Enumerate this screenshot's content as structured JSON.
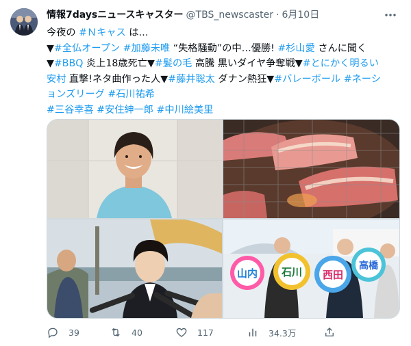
{
  "tweet": {
    "author_name": "情報7daysニュースキャスター",
    "handle": "@TBS_newscaster",
    "separator": "·",
    "date": "6月10日",
    "more_icon": "more-horizontal-icon",
    "body": {
      "l1": {
        "a": "今夜の ",
        "tag1": "#Ｎキャス",
        "b": " は…"
      },
      "l2": {
        "a": "▼",
        "tag1": "#全仏オープン",
        "b": " ",
        "tag2": "#加藤未唯",
        "c": " “失格騒動”の中…優勝! ",
        "tag3": "#杉山愛",
        "d": " さんに聞く"
      },
      "l3": {
        "a": "▼",
        "tag1": "#BBQ",
        "b": " 炎上18歳死亡▼",
        "tag2": "#髪の毛",
        "c": " 高騰 黒いダイヤ争奪戦▼",
        "tag3": "#とにかく明るい"
      },
      "l4": {
        "tag1": "安村",
        "a": " 直撃!ネタ曲作った人▼",
        "tag2": "#藤井聡太",
        "b": " ダナン熱狂▼",
        "tag3": "#バレーボール",
        "c": " ",
        "tag4": "#ネーシ"
      },
      "l5": {
        "tag1": "ョンズリーグ",
        "a": " ",
        "tag2": "#石川祐希"
      },
      "l6": {
        "tag1": "#三谷幸喜",
        "a": " ",
        "tag2": "#安住紳一郎",
        "b": " ",
        "tag3": "#中川絵美里"
      }
    },
    "media": {
      "signs": [
        "山内",
        "石川",
        "西田",
        "高橋"
      ]
    },
    "actions": {
      "reply": {
        "icon": "reply-icon",
        "count": "39"
      },
      "retweet": {
        "icon": "retweet-icon",
        "count": "40"
      },
      "like": {
        "icon": "heart-icon",
        "count": "117"
      },
      "views": {
        "icon": "views-chart-icon",
        "count": "34.3万"
      },
      "share": {
        "icon": "share-icon"
      }
    }
  },
  "colors": {
    "link": "#1d9bf0",
    "text": "#0f1419",
    "muted": "#536471",
    "border": "#cfd9de"
  }
}
